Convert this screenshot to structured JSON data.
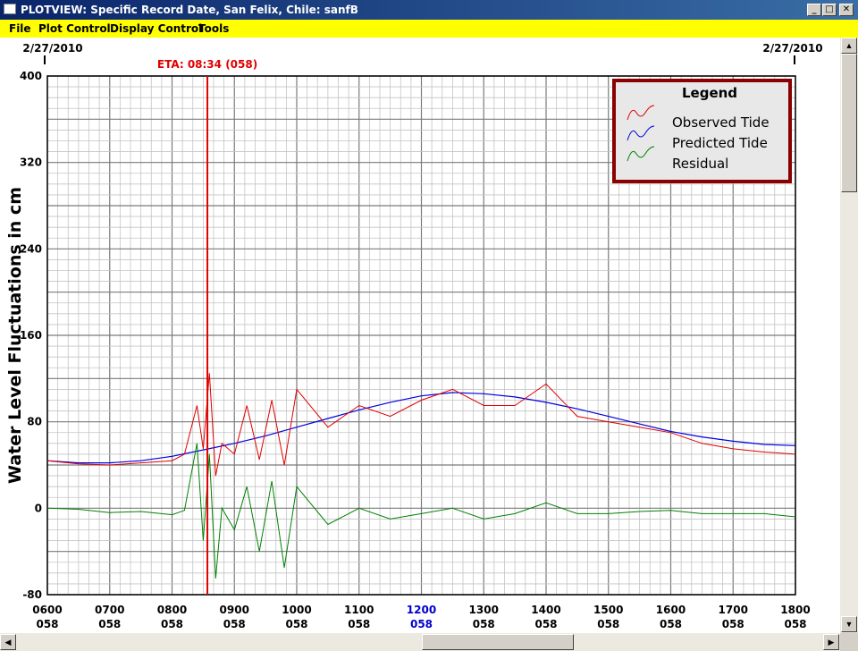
{
  "window": {
    "title": "PLOTVIEW: Specific Record Date, San Felix, Chile: sanfB",
    "minimize_glyph": "_",
    "maximize_glyph": "□",
    "close_glyph": "✕"
  },
  "menu": [
    {
      "label": "File"
    },
    {
      "label": "Plot Control"
    },
    {
      "label": "Display Control"
    },
    {
      "label": "Tools"
    }
  ],
  "plot": {
    "date_left": "2/27/2010",
    "date_right": "2/27/2010",
    "eta_label": "ETA: 08:34 (058)",
    "eta_time_hours": 8.567,
    "legend": {
      "title": "Legend",
      "entries": [
        "Observed Tide",
        "Predicted Tide",
        "Residual"
      ]
    },
    "colors": {
      "observed": "#e00000",
      "predicted": "#0000e0",
      "residual": "#008000",
      "eta": "#e00000",
      "highlight_tick": "#0000cc",
      "legend_border": "#8b0000"
    }
  },
  "chart_data": {
    "type": "line",
    "title": "",
    "xlabel": "",
    "ylabel": "Water Level Fluctuations in cm",
    "xlim": [
      6,
      18
    ],
    "ylim": [
      -80,
      400
    ],
    "x_ticks": [
      {
        "time": "0600",
        "day": "058"
      },
      {
        "time": "0700",
        "day": "058"
      },
      {
        "time": "0800",
        "day": "058"
      },
      {
        "time": "0900",
        "day": "058"
      },
      {
        "time": "1000",
        "day": "058"
      },
      {
        "time": "1100",
        "day": "058"
      },
      {
        "time": "1200",
        "day": "058",
        "highlight": true
      },
      {
        "time": "1300",
        "day": "058"
      },
      {
        "time": "1400",
        "day": "058"
      },
      {
        "time": "1500",
        "day": "058"
      },
      {
        "time": "1600",
        "day": "058"
      },
      {
        "time": "1700",
        "day": "058"
      },
      {
        "time": "1800",
        "day": "058"
      }
    ],
    "y_ticks": [
      "400",
      "320",
      "240",
      "160",
      "80",
      "0",
      "-80"
    ],
    "legend_position": "top-right",
    "grid": true,
    "series": [
      {
        "name": "Predicted Tide",
        "x": [
          6,
          6.5,
          7,
          7.5,
          8,
          8.5,
          9,
          9.5,
          10,
          10.5,
          11,
          11.5,
          12,
          12.5,
          13,
          13.5,
          14,
          14.5,
          15,
          15.5,
          16,
          16.5,
          17,
          17.5,
          18
        ],
        "y": [
          44,
          42,
          42,
          44,
          48,
          54,
          60,
          67,
          75,
          83,
          91,
          98,
          104,
          107,
          106,
          103,
          98,
          92,
          85,
          78,
          71,
          66,
          62,
          59,
          58
        ]
      },
      {
        "name": "Observed Tide",
        "x": [
          6,
          6.5,
          7,
          7.5,
          8,
          8.2,
          8.4,
          8.5,
          8.6,
          8.7,
          8.8,
          9,
          9.2,
          9.4,
          9.6,
          9.8,
          10,
          10.5,
          11,
          11.5,
          12,
          12.5,
          13,
          13.5,
          14,
          14.5,
          15,
          15.5,
          16,
          16.5,
          17,
          17.5,
          18
        ],
        "y": [
          44,
          41,
          40,
          42,
          44,
          50,
          95,
          55,
          125,
          30,
          60,
          50,
          95,
          45,
          100,
          40,
          110,
          75,
          95,
          85,
          100,
          110,
          95,
          95,
          115,
          85,
          80,
          75,
          70,
          60,
          55,
          52,
          50
        ]
      },
      {
        "name": "Residual",
        "x": [
          6,
          6.5,
          7,
          7.5,
          8,
          8.2,
          8.4,
          8.5,
          8.6,
          8.7,
          8.8,
          9,
          9.2,
          9.4,
          9.6,
          9.8,
          10,
          10.5,
          11,
          11.5,
          12,
          12.5,
          13,
          13.5,
          14,
          14.5,
          15,
          15.5,
          16,
          16.5,
          17,
          17.5,
          18
        ],
        "y": [
          0,
          -1,
          -4,
          -3,
          -6,
          -2,
          60,
          -30,
          50,
          -65,
          0,
          -20,
          20,
          -40,
          25,
          -55,
          20,
          -15,
          0,
          -10,
          -5,
          0,
          -10,
          -5,
          5,
          -5,
          -5,
          -3,
          -2,
          -5,
          -5,
          -5,
          -8
        ]
      }
    ]
  }
}
